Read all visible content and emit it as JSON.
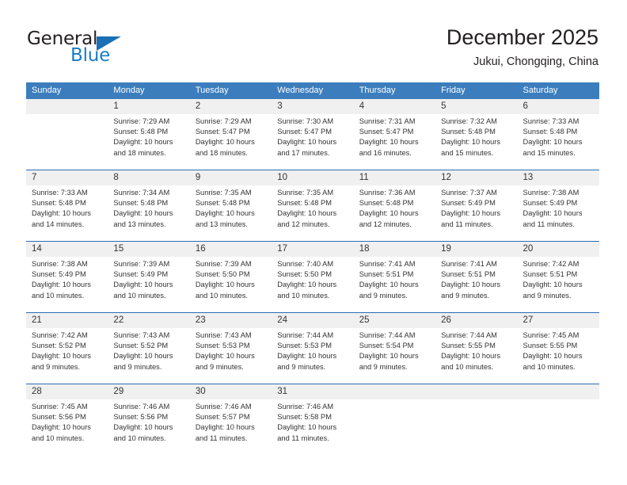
{
  "brand": {
    "line1": "General",
    "line2": "Blue",
    "triangle_icon": "triangle-icon",
    "color_dark": "#231f20",
    "color_blue": "#1a7dc4"
  },
  "header": {
    "title": "December 2025",
    "subtitle": "Jukui, Chongqing, China"
  },
  "theme": {
    "header_blue": "#3c7ebd",
    "separator_blue": "#2a6db3",
    "date_band_gray": "#f0f0f0",
    "text_dark": "#333333"
  },
  "weekdays": [
    "Sunday",
    "Monday",
    "Tuesday",
    "Wednesday",
    "Thursday",
    "Friday",
    "Saturday"
  ],
  "weeks": [
    [
      {
        "day": "",
        "sunrise": "",
        "sunset": "",
        "daylight1": "",
        "daylight2": ""
      },
      {
        "day": "1",
        "sunrise": "Sunrise: 7:29 AM",
        "sunset": "Sunset: 5:48 PM",
        "daylight1": "Daylight: 10 hours",
        "daylight2": "and 18 minutes."
      },
      {
        "day": "2",
        "sunrise": "Sunrise: 7:29 AM",
        "sunset": "Sunset: 5:47 PM",
        "daylight1": "Daylight: 10 hours",
        "daylight2": "and 18 minutes."
      },
      {
        "day": "3",
        "sunrise": "Sunrise: 7:30 AM",
        "sunset": "Sunset: 5:47 PM",
        "daylight1": "Daylight: 10 hours",
        "daylight2": "and 17 minutes."
      },
      {
        "day": "4",
        "sunrise": "Sunrise: 7:31 AM",
        "sunset": "Sunset: 5:47 PM",
        "daylight1": "Daylight: 10 hours",
        "daylight2": "and 16 minutes."
      },
      {
        "day": "5",
        "sunrise": "Sunrise: 7:32 AM",
        "sunset": "Sunset: 5:48 PM",
        "daylight1": "Daylight: 10 hours",
        "daylight2": "and 15 minutes."
      },
      {
        "day": "6",
        "sunrise": "Sunrise: 7:33 AM",
        "sunset": "Sunset: 5:48 PM",
        "daylight1": "Daylight: 10 hours",
        "daylight2": "and 15 minutes."
      }
    ],
    [
      {
        "day": "7",
        "sunrise": "Sunrise: 7:33 AM",
        "sunset": "Sunset: 5:48 PM",
        "daylight1": "Daylight: 10 hours",
        "daylight2": "and 14 minutes."
      },
      {
        "day": "8",
        "sunrise": "Sunrise: 7:34 AM",
        "sunset": "Sunset: 5:48 PM",
        "daylight1": "Daylight: 10 hours",
        "daylight2": "and 13 minutes."
      },
      {
        "day": "9",
        "sunrise": "Sunrise: 7:35 AM",
        "sunset": "Sunset: 5:48 PM",
        "daylight1": "Daylight: 10 hours",
        "daylight2": "and 13 minutes."
      },
      {
        "day": "10",
        "sunrise": "Sunrise: 7:35 AM",
        "sunset": "Sunset: 5:48 PM",
        "daylight1": "Daylight: 10 hours",
        "daylight2": "and 12 minutes."
      },
      {
        "day": "11",
        "sunrise": "Sunrise: 7:36 AM",
        "sunset": "Sunset: 5:48 PM",
        "daylight1": "Daylight: 10 hours",
        "daylight2": "and 12 minutes."
      },
      {
        "day": "12",
        "sunrise": "Sunrise: 7:37 AM",
        "sunset": "Sunset: 5:49 PM",
        "daylight1": "Daylight: 10 hours",
        "daylight2": "and 11 minutes."
      },
      {
        "day": "13",
        "sunrise": "Sunrise: 7:38 AM",
        "sunset": "Sunset: 5:49 PM",
        "daylight1": "Daylight: 10 hours",
        "daylight2": "and 11 minutes."
      }
    ],
    [
      {
        "day": "14",
        "sunrise": "Sunrise: 7:38 AM",
        "sunset": "Sunset: 5:49 PM",
        "daylight1": "Daylight: 10 hours",
        "daylight2": "and 10 minutes."
      },
      {
        "day": "15",
        "sunrise": "Sunrise: 7:39 AM",
        "sunset": "Sunset: 5:49 PM",
        "daylight1": "Daylight: 10 hours",
        "daylight2": "and 10 minutes."
      },
      {
        "day": "16",
        "sunrise": "Sunrise: 7:39 AM",
        "sunset": "Sunset: 5:50 PM",
        "daylight1": "Daylight: 10 hours",
        "daylight2": "and 10 minutes."
      },
      {
        "day": "17",
        "sunrise": "Sunrise: 7:40 AM",
        "sunset": "Sunset: 5:50 PM",
        "daylight1": "Daylight: 10 hours",
        "daylight2": "and 10 minutes."
      },
      {
        "day": "18",
        "sunrise": "Sunrise: 7:41 AM",
        "sunset": "Sunset: 5:51 PM",
        "daylight1": "Daylight: 10 hours",
        "daylight2": "and 9 minutes."
      },
      {
        "day": "19",
        "sunrise": "Sunrise: 7:41 AM",
        "sunset": "Sunset: 5:51 PM",
        "daylight1": "Daylight: 10 hours",
        "daylight2": "and 9 minutes."
      },
      {
        "day": "20",
        "sunrise": "Sunrise: 7:42 AM",
        "sunset": "Sunset: 5:51 PM",
        "daylight1": "Daylight: 10 hours",
        "daylight2": "and 9 minutes."
      }
    ],
    [
      {
        "day": "21",
        "sunrise": "Sunrise: 7:42 AM",
        "sunset": "Sunset: 5:52 PM",
        "daylight1": "Daylight: 10 hours",
        "daylight2": "and 9 minutes."
      },
      {
        "day": "22",
        "sunrise": "Sunrise: 7:43 AM",
        "sunset": "Sunset: 5:52 PM",
        "daylight1": "Daylight: 10 hours",
        "daylight2": "and 9 minutes."
      },
      {
        "day": "23",
        "sunrise": "Sunrise: 7:43 AM",
        "sunset": "Sunset: 5:53 PM",
        "daylight1": "Daylight: 10 hours",
        "daylight2": "and 9 minutes."
      },
      {
        "day": "24",
        "sunrise": "Sunrise: 7:44 AM",
        "sunset": "Sunset: 5:53 PM",
        "daylight1": "Daylight: 10 hours",
        "daylight2": "and 9 minutes."
      },
      {
        "day": "25",
        "sunrise": "Sunrise: 7:44 AM",
        "sunset": "Sunset: 5:54 PM",
        "daylight1": "Daylight: 10 hours",
        "daylight2": "and 9 minutes."
      },
      {
        "day": "26",
        "sunrise": "Sunrise: 7:44 AM",
        "sunset": "Sunset: 5:55 PM",
        "daylight1": "Daylight: 10 hours",
        "daylight2": "and 10 minutes."
      },
      {
        "day": "27",
        "sunrise": "Sunrise: 7:45 AM",
        "sunset": "Sunset: 5:55 PM",
        "daylight1": "Daylight: 10 hours",
        "daylight2": "and 10 minutes."
      }
    ],
    [
      {
        "day": "28",
        "sunrise": "Sunrise: 7:45 AM",
        "sunset": "Sunset: 5:56 PM",
        "daylight1": "Daylight: 10 hours",
        "daylight2": "and 10 minutes."
      },
      {
        "day": "29",
        "sunrise": "Sunrise: 7:46 AM",
        "sunset": "Sunset: 5:56 PM",
        "daylight1": "Daylight: 10 hours",
        "daylight2": "and 10 minutes."
      },
      {
        "day": "30",
        "sunrise": "Sunrise: 7:46 AM",
        "sunset": "Sunset: 5:57 PM",
        "daylight1": "Daylight: 10 hours",
        "daylight2": "and 11 minutes."
      },
      {
        "day": "31",
        "sunrise": "Sunrise: 7:46 AM",
        "sunset": "Sunset: 5:58 PM",
        "daylight1": "Daylight: 10 hours",
        "daylight2": "and 11 minutes."
      },
      {
        "day": "",
        "sunrise": "",
        "sunset": "",
        "daylight1": "",
        "daylight2": ""
      },
      {
        "day": "",
        "sunrise": "",
        "sunset": "",
        "daylight1": "",
        "daylight2": ""
      },
      {
        "day": "",
        "sunrise": "",
        "sunset": "",
        "daylight1": "",
        "daylight2": ""
      }
    ]
  ]
}
